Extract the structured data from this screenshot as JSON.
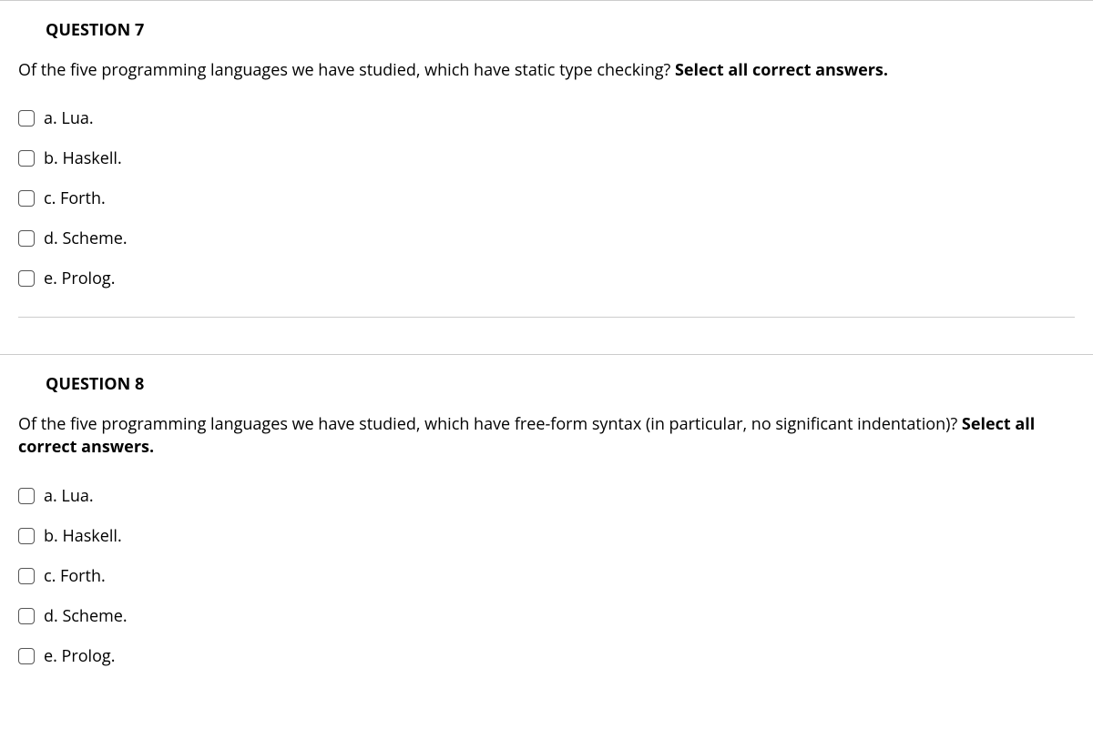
{
  "questions": [
    {
      "header": "QUESTION 7",
      "prompt_plain": "Of the five programming languages we have studied, which have static type checking? ",
      "prompt_bold": "Select all correct answers.",
      "options": [
        {
          "letter": "a.",
          "text": "Lua."
        },
        {
          "letter": "b.",
          "text": "Haskell."
        },
        {
          "letter": "c.",
          "text": "Forth."
        },
        {
          "letter": "d.",
          "text": "Scheme."
        },
        {
          "letter": "e.",
          "text": "Prolog."
        }
      ]
    },
    {
      "header": "QUESTION 8",
      "prompt_plain": "Of the five programming languages we have studied, which have free-form syntax (in particular, no significant indentation)? ",
      "prompt_bold": "Select all correct answers.",
      "options": [
        {
          "letter": "a.",
          "text": "Lua."
        },
        {
          "letter": "b.",
          "text": "Haskell."
        },
        {
          "letter": "c.",
          "text": "Forth."
        },
        {
          "letter": "d.",
          "text": "Scheme."
        },
        {
          "letter": "e.",
          "text": "Prolog."
        }
      ]
    }
  ]
}
